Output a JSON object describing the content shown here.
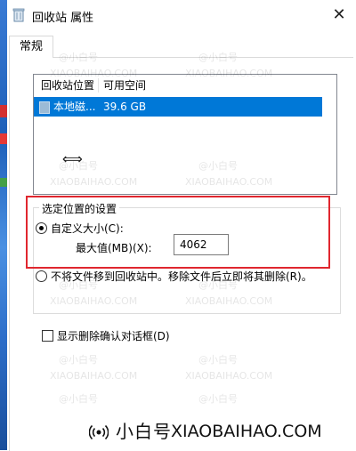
{
  "window": {
    "title": "回收站 属性",
    "close_glyph": "✕"
  },
  "tabs": [
    {
      "label": "常规"
    }
  ],
  "listview": {
    "headers": [
      "回收站位置",
      "可用空间"
    ],
    "rows": [
      {
        "location": "本地磁...",
        "free_space": "39.6 GB",
        "selected": true
      }
    ]
  },
  "settings_group": {
    "label": "选定位置的设置",
    "custom_size_label": "自定义大小(C):",
    "max_value_label": "最大值(MB)(X):",
    "max_value": "4062",
    "no_recycle_label": "不将文件移到回收站中。移除文件后立即将其删除(R)。",
    "selected_option": "custom_size"
  },
  "confirm_checkbox": {
    "label": "显示删除确认对话框(D)",
    "checked": false
  },
  "watermark": {
    "brand": "小白号",
    "url": "XIAOBAIHAO.COM",
    "tile_text": "@小白号",
    "tile_url": "XIAOBAIHAO.COM"
  },
  "colors": {
    "selection": "#0078d7",
    "highlight_box": "#e0272f"
  },
  "icons": {
    "title": "recycle-bin-icon",
    "drive": "drive-icon",
    "cursor": "resize-horizontal-cursor-icon",
    "watermark": "signal-icon"
  }
}
